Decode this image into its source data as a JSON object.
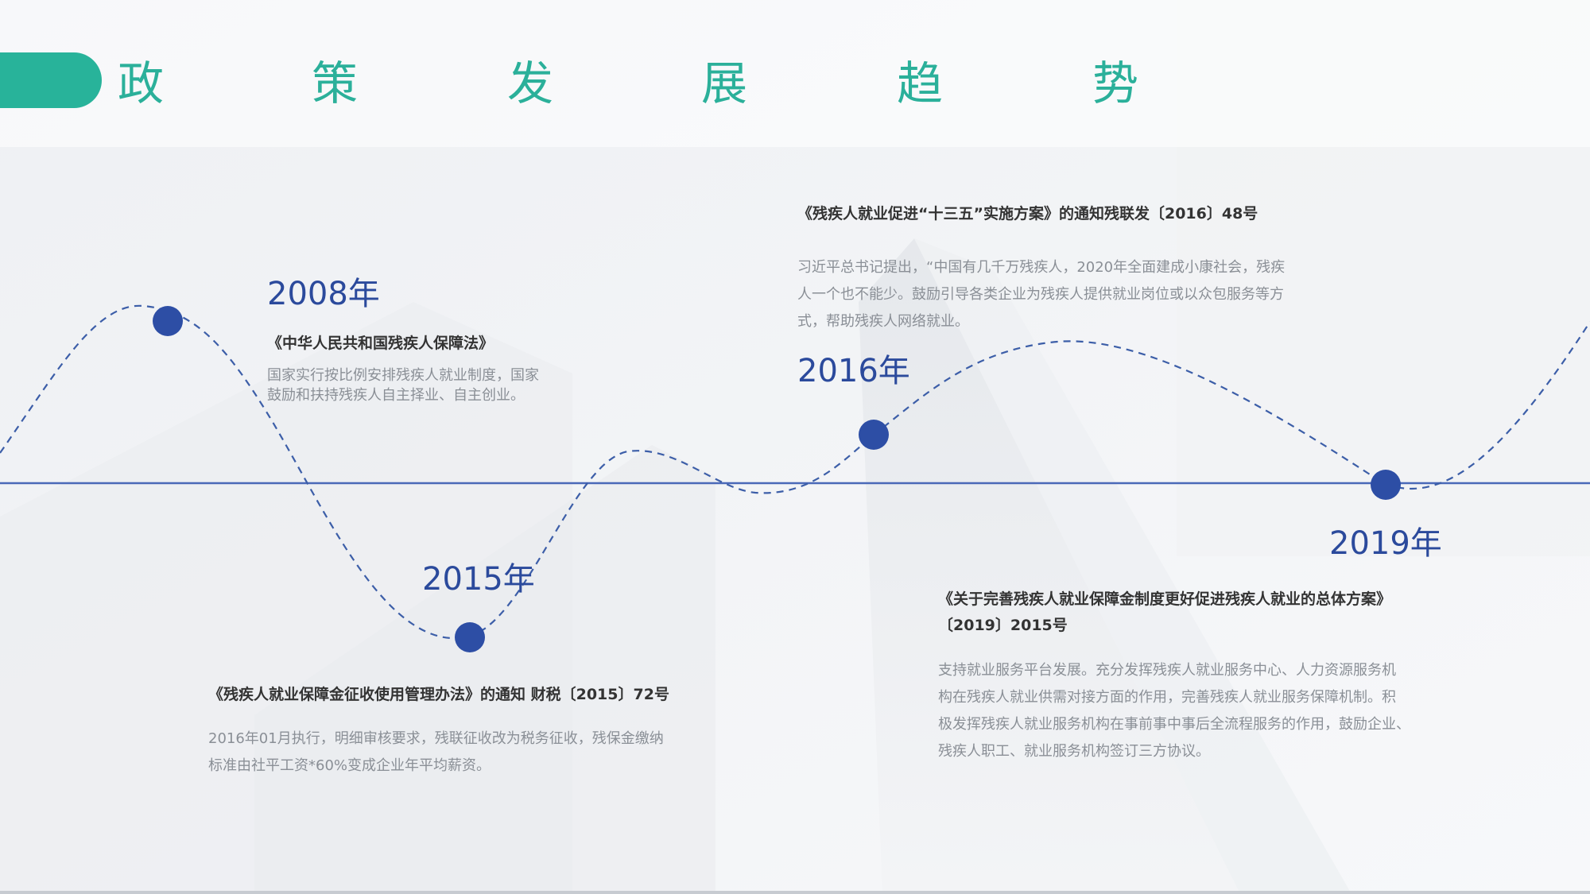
{
  "title": {
    "chars": [
      "政",
      "策",
      "发",
      "展",
      "趋",
      "势"
    ]
  },
  "colors": {
    "accent": "#28b39a",
    "title": "#2bb09a",
    "year": "#2b4a9c",
    "dot": "#2d4ea5",
    "axis": "#4a69b8"
  },
  "milestones": [
    {
      "year": "2008年",
      "heading": "《中华人民共和国残疾人保障法》",
      "lines": [
        "国家实行按比例安排残疾人就业制度，国家",
        "鼓励和扶持残疾人自主择业、自主创业。"
      ]
    },
    {
      "year": "2015年",
      "heading": "《残疾人就业保障金征收使用管理办法》的通知 财税〔2015〕72号",
      "lines": [
        "2016年01月执行，明细审核要求，残联征收改为税务征收，残保金缴纳",
        "标准由社平工资*60%变成企业年平均薪资。"
      ]
    },
    {
      "year": "2016年",
      "heading": "《残疾人就业促进“十三五”实施方案》的通知残联发〔2016〕48号",
      "lines": [
        "习近平总书记提出，“中国有几千万残疾人，2020年全面建成小康社会，残疾",
        "人一个也不能少。鼓励引导各类企业为残疾人提供就业岗位或以众包服务等方",
        "式，帮助残疾人网络就业。"
      ]
    },
    {
      "year": "2019年",
      "heading_lines": [
        "《关于完善残疾人就业保障金制度更好促进残疾人就业的总体方案》",
        "〔2019〕2015号"
      ],
      "lines": [
        "支持就业服务平台发展。充分发挥残疾人就业服务中心、人力资源服务机",
        "构在残疾人就业供需对接方面的作用，完善残疾人就业服务保障机制。积",
        "极发挥残疾人就业服务机构在事前事中事后全流程服务的作用，鼓励企业、",
        "残疾人职工、就业服务机构签订三方协议。"
      ]
    }
  ]
}
